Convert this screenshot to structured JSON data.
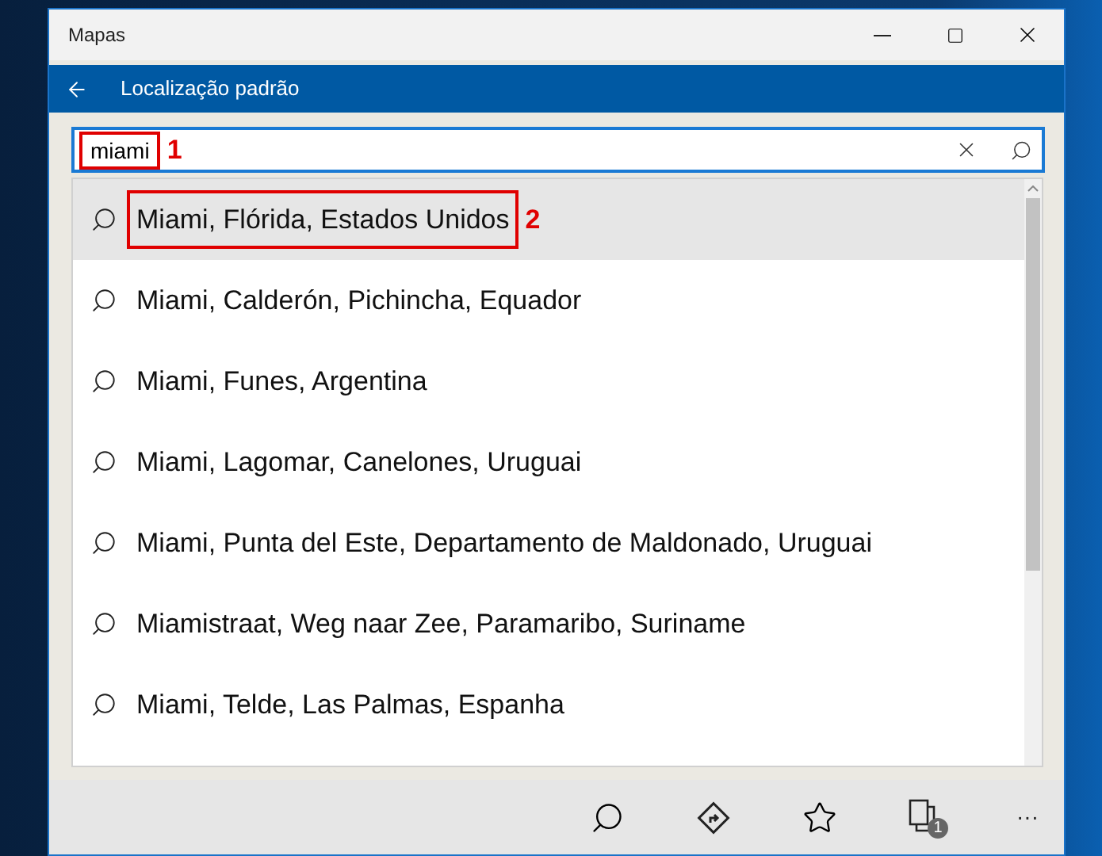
{
  "window": {
    "title": "Mapas"
  },
  "header": {
    "title": "Localização padrão"
  },
  "search": {
    "value": "miami",
    "annotation": "1"
  },
  "suggestions": [
    {
      "text": "Miami, Flórida, Estados Unidos",
      "selected": true,
      "annotation": "2"
    },
    {
      "text": "Miami, Calderón, Pichincha, Equador",
      "selected": false
    },
    {
      "text": "Miami, Funes, Argentina",
      "selected": false
    },
    {
      "text": "Miami, Lagomar, Canelones, Uruguai",
      "selected": false
    },
    {
      "text": "Miami, Punta del Este, Departamento de Maldonado, Uruguai",
      "selected": false
    },
    {
      "text": "Miamistraat, Weg naar Zee, Paramaribo, Suriname",
      "selected": false
    },
    {
      "text": "Miami, Telde, Las Palmas, Espanha",
      "selected": false
    }
  ],
  "toolbar": {
    "tabs_badge": "1",
    "more": "···"
  }
}
